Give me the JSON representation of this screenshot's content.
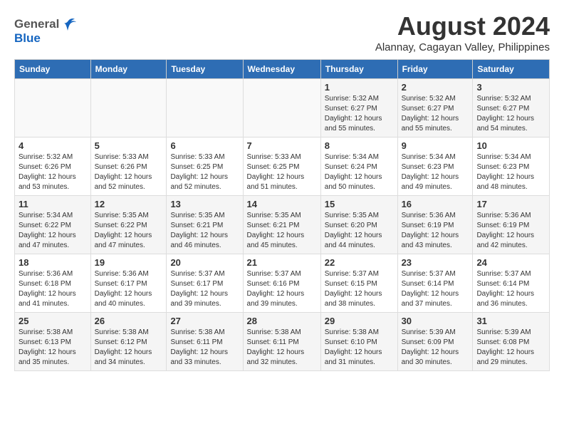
{
  "header": {
    "logo_general": "General",
    "logo_blue": "Blue",
    "month_year": "August 2024",
    "location": "Alannay, Cagayan Valley, Philippines"
  },
  "weekdays": [
    "Sunday",
    "Monday",
    "Tuesday",
    "Wednesday",
    "Thursday",
    "Friday",
    "Saturday"
  ],
  "weeks": [
    [
      {
        "day": "",
        "sunrise": "",
        "sunset": "",
        "daylight": ""
      },
      {
        "day": "",
        "sunrise": "",
        "sunset": "",
        "daylight": ""
      },
      {
        "day": "",
        "sunrise": "",
        "sunset": "",
        "daylight": ""
      },
      {
        "day": "",
        "sunrise": "",
        "sunset": "",
        "daylight": ""
      },
      {
        "day": "1",
        "sunrise": "Sunrise: 5:32 AM",
        "sunset": "Sunset: 6:27 PM",
        "daylight": "Daylight: 12 hours and 55 minutes."
      },
      {
        "day": "2",
        "sunrise": "Sunrise: 5:32 AM",
        "sunset": "Sunset: 6:27 PM",
        "daylight": "Daylight: 12 hours and 55 minutes."
      },
      {
        "day": "3",
        "sunrise": "Sunrise: 5:32 AM",
        "sunset": "Sunset: 6:27 PM",
        "daylight": "Daylight: 12 hours and 54 minutes."
      }
    ],
    [
      {
        "day": "4",
        "sunrise": "Sunrise: 5:32 AM",
        "sunset": "Sunset: 6:26 PM",
        "daylight": "Daylight: 12 hours and 53 minutes."
      },
      {
        "day": "5",
        "sunrise": "Sunrise: 5:33 AM",
        "sunset": "Sunset: 6:26 PM",
        "daylight": "Daylight: 12 hours and 52 minutes."
      },
      {
        "day": "6",
        "sunrise": "Sunrise: 5:33 AM",
        "sunset": "Sunset: 6:25 PM",
        "daylight": "Daylight: 12 hours and 52 minutes."
      },
      {
        "day": "7",
        "sunrise": "Sunrise: 5:33 AM",
        "sunset": "Sunset: 6:25 PM",
        "daylight": "Daylight: 12 hours and 51 minutes."
      },
      {
        "day": "8",
        "sunrise": "Sunrise: 5:34 AM",
        "sunset": "Sunset: 6:24 PM",
        "daylight": "Daylight: 12 hours and 50 minutes."
      },
      {
        "day": "9",
        "sunrise": "Sunrise: 5:34 AM",
        "sunset": "Sunset: 6:23 PM",
        "daylight": "Daylight: 12 hours and 49 minutes."
      },
      {
        "day": "10",
        "sunrise": "Sunrise: 5:34 AM",
        "sunset": "Sunset: 6:23 PM",
        "daylight": "Daylight: 12 hours and 48 minutes."
      }
    ],
    [
      {
        "day": "11",
        "sunrise": "Sunrise: 5:34 AM",
        "sunset": "Sunset: 6:22 PM",
        "daylight": "Daylight: 12 hours and 47 minutes."
      },
      {
        "day": "12",
        "sunrise": "Sunrise: 5:35 AM",
        "sunset": "Sunset: 6:22 PM",
        "daylight": "Daylight: 12 hours and 47 minutes."
      },
      {
        "day": "13",
        "sunrise": "Sunrise: 5:35 AM",
        "sunset": "Sunset: 6:21 PM",
        "daylight": "Daylight: 12 hours and 46 minutes."
      },
      {
        "day": "14",
        "sunrise": "Sunrise: 5:35 AM",
        "sunset": "Sunset: 6:21 PM",
        "daylight": "Daylight: 12 hours and 45 minutes."
      },
      {
        "day": "15",
        "sunrise": "Sunrise: 5:35 AM",
        "sunset": "Sunset: 6:20 PM",
        "daylight": "Daylight: 12 hours and 44 minutes."
      },
      {
        "day": "16",
        "sunrise": "Sunrise: 5:36 AM",
        "sunset": "Sunset: 6:19 PM",
        "daylight": "Daylight: 12 hours and 43 minutes."
      },
      {
        "day": "17",
        "sunrise": "Sunrise: 5:36 AM",
        "sunset": "Sunset: 6:19 PM",
        "daylight": "Daylight: 12 hours and 42 minutes."
      }
    ],
    [
      {
        "day": "18",
        "sunrise": "Sunrise: 5:36 AM",
        "sunset": "Sunset: 6:18 PM",
        "daylight": "Daylight: 12 hours and 41 minutes."
      },
      {
        "day": "19",
        "sunrise": "Sunrise: 5:36 AM",
        "sunset": "Sunset: 6:17 PM",
        "daylight": "Daylight: 12 hours and 40 minutes."
      },
      {
        "day": "20",
        "sunrise": "Sunrise: 5:37 AM",
        "sunset": "Sunset: 6:17 PM",
        "daylight": "Daylight: 12 hours and 39 minutes."
      },
      {
        "day": "21",
        "sunrise": "Sunrise: 5:37 AM",
        "sunset": "Sunset: 6:16 PM",
        "daylight": "Daylight: 12 hours and 39 minutes."
      },
      {
        "day": "22",
        "sunrise": "Sunrise: 5:37 AM",
        "sunset": "Sunset: 6:15 PM",
        "daylight": "Daylight: 12 hours and 38 minutes."
      },
      {
        "day": "23",
        "sunrise": "Sunrise: 5:37 AM",
        "sunset": "Sunset: 6:14 PM",
        "daylight": "Daylight: 12 hours and 37 minutes."
      },
      {
        "day": "24",
        "sunrise": "Sunrise: 5:37 AM",
        "sunset": "Sunset: 6:14 PM",
        "daylight": "Daylight: 12 hours and 36 minutes."
      }
    ],
    [
      {
        "day": "25",
        "sunrise": "Sunrise: 5:38 AM",
        "sunset": "Sunset: 6:13 PM",
        "daylight": "Daylight: 12 hours and 35 minutes."
      },
      {
        "day": "26",
        "sunrise": "Sunrise: 5:38 AM",
        "sunset": "Sunset: 6:12 PM",
        "daylight": "Daylight: 12 hours and 34 minutes."
      },
      {
        "day": "27",
        "sunrise": "Sunrise: 5:38 AM",
        "sunset": "Sunset: 6:11 PM",
        "daylight": "Daylight: 12 hours and 33 minutes."
      },
      {
        "day": "28",
        "sunrise": "Sunrise: 5:38 AM",
        "sunset": "Sunset: 6:11 PM",
        "daylight": "Daylight: 12 hours and 32 minutes."
      },
      {
        "day": "29",
        "sunrise": "Sunrise: 5:38 AM",
        "sunset": "Sunset: 6:10 PM",
        "daylight": "Daylight: 12 hours and 31 minutes."
      },
      {
        "day": "30",
        "sunrise": "Sunrise: 5:39 AM",
        "sunset": "Sunset: 6:09 PM",
        "daylight": "Daylight: 12 hours and 30 minutes."
      },
      {
        "day": "31",
        "sunrise": "Sunrise: 5:39 AM",
        "sunset": "Sunset: 6:08 PM",
        "daylight": "Daylight: 12 hours and 29 minutes."
      }
    ]
  ]
}
